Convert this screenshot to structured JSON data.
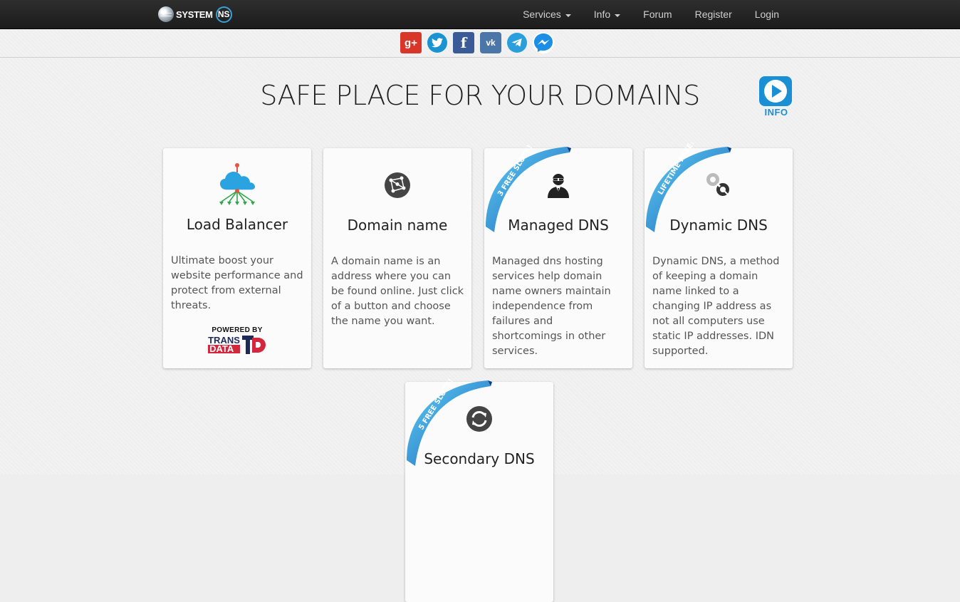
{
  "brand": {
    "text": "SYSTEM",
    "badge": "NS"
  },
  "nav": {
    "items": [
      {
        "label": "Services",
        "dropdown": true
      },
      {
        "label": "Info",
        "dropdown": true
      },
      {
        "label": "Forum",
        "dropdown": false
      },
      {
        "label": "Register",
        "dropdown": false
      },
      {
        "label": "Login",
        "dropdown": false
      }
    ]
  },
  "share": {
    "icons": [
      "google-plus-icon",
      "twitter-icon",
      "facebook-icon",
      "vk-icon",
      "telegram-icon",
      "messenger-icon"
    ],
    "gplus_glyph": "g+",
    "vk_glyph": "vk",
    "fb_glyph": "f"
  },
  "hero": {
    "title": "SAFE PLACE FOR YOUR DOMAINS",
    "info_label": "INFO"
  },
  "cards": [
    {
      "title": "Load Balancer",
      "desc": "Ultimate boost your website performance and protect from external threats.",
      "icon": "cloud-network-icon",
      "powered_by": "POWERED BY",
      "partner_line1": "TRANS",
      "partner_line2": "DATA"
    },
    {
      "title": "Domain name",
      "desc": "A domain name is an address where you can be found online. Just click of a button and choose the name you want.",
      "icon": "network-globe-icon"
    },
    {
      "title": "Managed DNS",
      "desc": "Managed dns hosting services help domain name owners maintain independence from failures and shortcomings in other services.",
      "icon": "agent-icon",
      "ribbon": "3 FREE SLOTS!"
    },
    {
      "title": "Dynamic DNS",
      "desc": "Dynamic DNS, a method of keeping a domain name linked to a changing IP address as not all computers use static IP addresses. IDN supported.",
      "icon": "dynamic-link-icon",
      "ribbon": "LIFETIME FREE!"
    },
    {
      "title": "Secondary DNS",
      "desc": "",
      "icon": "sync-icon",
      "ribbon": "5 FREE SLOTS!"
    }
  ],
  "colors": {
    "accent": "#1a8fd4",
    "ribbon": "#2a8fd8",
    "nav_bg": "#222222"
  }
}
